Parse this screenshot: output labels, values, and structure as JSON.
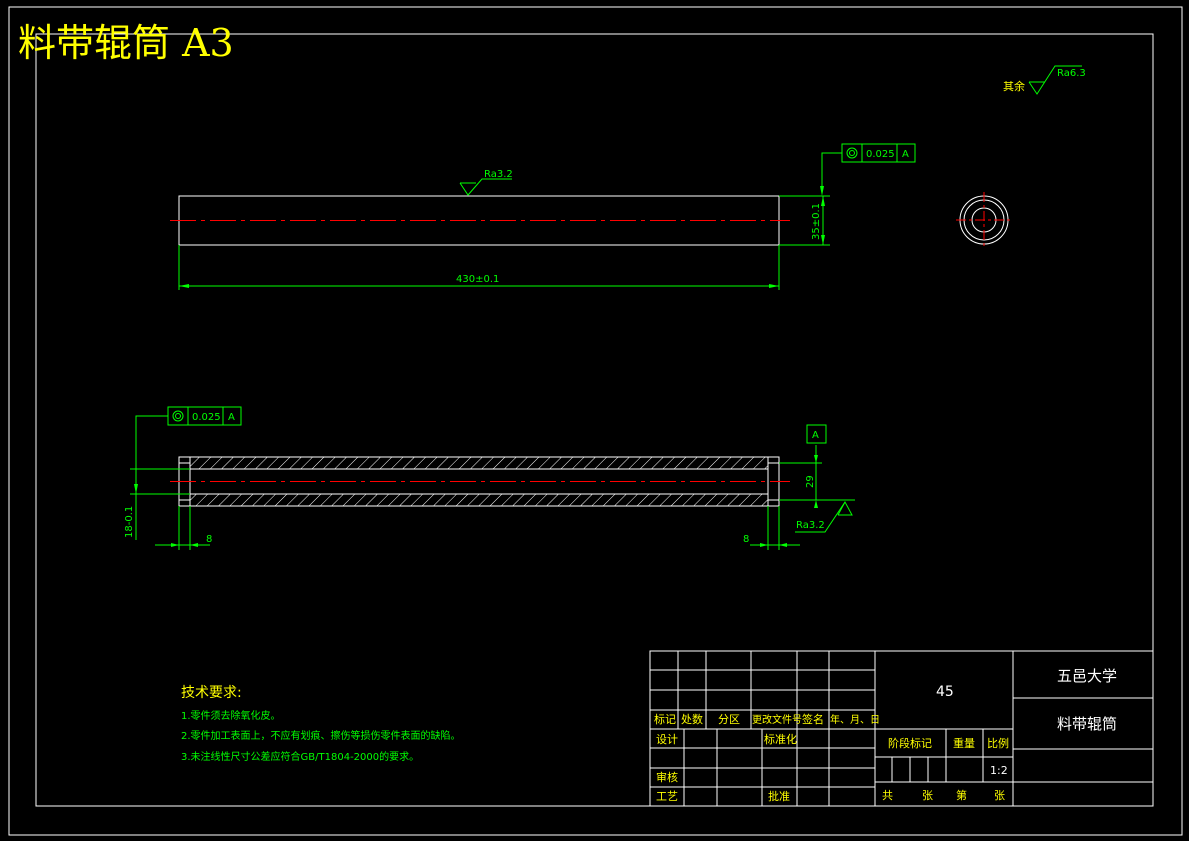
{
  "title": "料带辊筒 A3",
  "surface": {
    "other": "其余",
    "ra63": "Ra6.3",
    "ra32_top": "Ra3.2",
    "ra32_bottom": "Ra3.2"
  },
  "tolerance": {
    "top_value": "0.025",
    "top_datum": "A",
    "bottom_value": "0.025",
    "bottom_datum": "A",
    "datum_label": "A"
  },
  "dimensions": {
    "length": "430±0.1",
    "outer_dia": "35±0.1",
    "inner_dia": "29",
    "bore_dia": "18-0.1",
    "left_depth": "8",
    "right_depth": "8"
  },
  "tech_requirements": {
    "heading": "技术要求:",
    "items": [
      "1.零件须去除氧化皮。",
      "2.零件加工表面上，不应有划痕、擦伤等损伤零件表面的缺陷。",
      "3.未注线性尺寸公差应符合GB/T1804-2000的要求。"
    ]
  },
  "title_block": {
    "material": "45",
    "school": "五邑大学",
    "part_name": "料带辊筒",
    "headers": [
      "标记",
      "处数",
      "分区",
      "更改文件号",
      "签名",
      "年、月、日"
    ],
    "design": "设计",
    "standardize": "标准化",
    "stage_mark": "阶段标记",
    "weight": "重量",
    "scale_label": "比例",
    "scale": "1:2",
    "review": "审核",
    "process": "工艺",
    "approve": "批准",
    "total": "共",
    "sheets": "张",
    "number": "第",
    "sheet": "张"
  },
  "colors": {
    "outline": "#ffffff",
    "dimension": "#00ff00",
    "centerline": "#ff0000",
    "title": "#ffff00"
  }
}
